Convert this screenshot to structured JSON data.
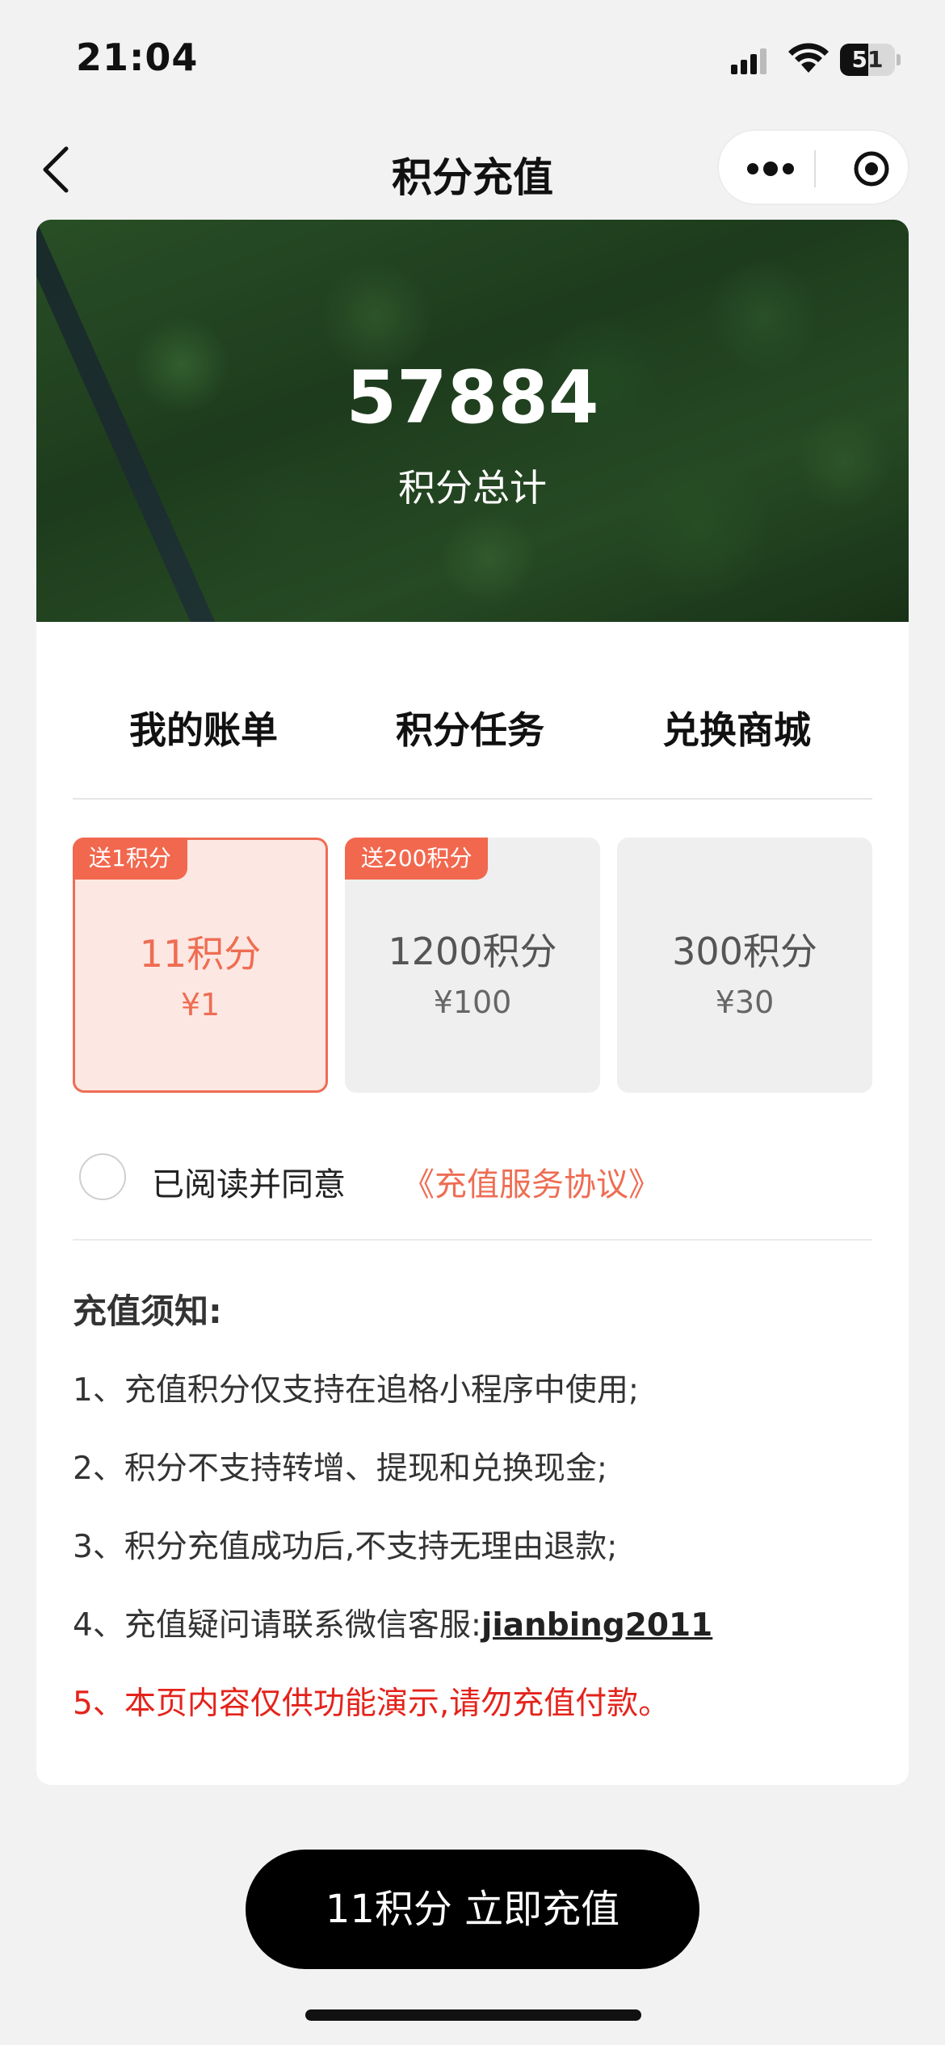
{
  "status_bar": {
    "time": "21:04",
    "battery_level": "51",
    "battery_fraction": 0.51,
    "icons": [
      "signal-icon",
      "wifi-icon",
      "battery-icon"
    ]
  },
  "nav": {
    "title": "积分充值",
    "icons": [
      "back-icon",
      "more-icon",
      "target-icon"
    ]
  },
  "hero": {
    "points_total": "57884",
    "points_label": "积分总计"
  },
  "tabs": [
    {
      "label": "我的账单"
    },
    {
      "label": "积分任务"
    },
    {
      "label": "兑换商城"
    }
  ],
  "packages": [
    {
      "badge": "送1积分",
      "points": "11积分",
      "price": "¥1",
      "selected": true
    },
    {
      "badge": "送200积分",
      "points": "1200积分",
      "price": "¥100",
      "selected": false
    },
    {
      "badge": "",
      "points": "300积分",
      "price": "¥30",
      "selected": false
    }
  ],
  "agreement": {
    "text": "已阅读并同意",
    "link": "《充值服务协议》",
    "checked": false
  },
  "notice": {
    "title": "充值须知:",
    "items": [
      "1、充值积分仅支持在追格小程序中使用;",
      "2、积分不支持转增、提现和兑换现金;",
      "3、积分充值成功后,不支持无理由退款;",
      "4、充值疑问请联系微信客服:",
      "5、本页内容仅供功能演示,请勿充值付款。"
    ],
    "contact": "jianbing2011"
  },
  "action": {
    "button_label": "11积分 立即充值"
  },
  "colors": {
    "accent": "#ee6d53",
    "badge": "#f2684e",
    "warning": "#e4231b",
    "button": "#000000"
  }
}
